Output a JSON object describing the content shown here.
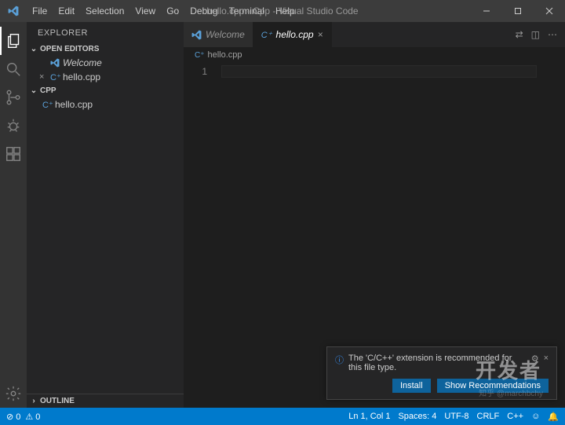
{
  "titlebar": {
    "title": "hello.cpp - Cpp - Visual Studio Code",
    "menu": [
      "File",
      "Edit",
      "Selection",
      "View",
      "Go",
      "Debug",
      "Terminal",
      "Help"
    ]
  },
  "activitybar": {
    "items": [
      {
        "name": "explorer-icon"
      },
      {
        "name": "search-icon"
      },
      {
        "name": "source-control-icon"
      },
      {
        "name": "debug-icon"
      },
      {
        "name": "extensions-icon"
      }
    ],
    "bottom": {
      "name": "settings-gear-icon"
    }
  },
  "sidebar": {
    "title": "EXPLORER",
    "openEditors": {
      "label": "OPEN EDITORS",
      "items": [
        {
          "icon": "vs",
          "label": "Welcome",
          "italic": true,
          "closeable": false
        },
        {
          "icon": "cpp",
          "label": "hello.cpp",
          "italic": false,
          "closeable": true
        }
      ]
    },
    "folder": {
      "label": "CPP",
      "items": [
        {
          "icon": "cpp",
          "label": "hello.cpp"
        }
      ]
    },
    "outline": "OUTLINE"
  },
  "tabs": [
    {
      "icon": "vs",
      "label": "Welcome",
      "active": false,
      "close": false
    },
    {
      "icon": "cpp",
      "label": "hello.cpp",
      "active": true,
      "close": true
    }
  ],
  "breadcrumb": {
    "icon": "cpp",
    "label": "hello.cpp"
  },
  "editor": {
    "lineNumbers": [
      "1"
    ]
  },
  "notification": {
    "text": "The 'C/C++' extension is recommended for this file type.",
    "buttons": [
      "Install",
      "Show Recommendations"
    ]
  },
  "statusbar": {
    "left": [
      "⊘ 0",
      "⚠ 0"
    ],
    "right": [
      "Ln 1, Col 1",
      "Spaces: 4",
      "UTF-8",
      "CRLF",
      "C++",
      "☺",
      "🔔"
    ]
  },
  "watermark": "开发者",
  "watermark2": "知乎 @marchbchy"
}
